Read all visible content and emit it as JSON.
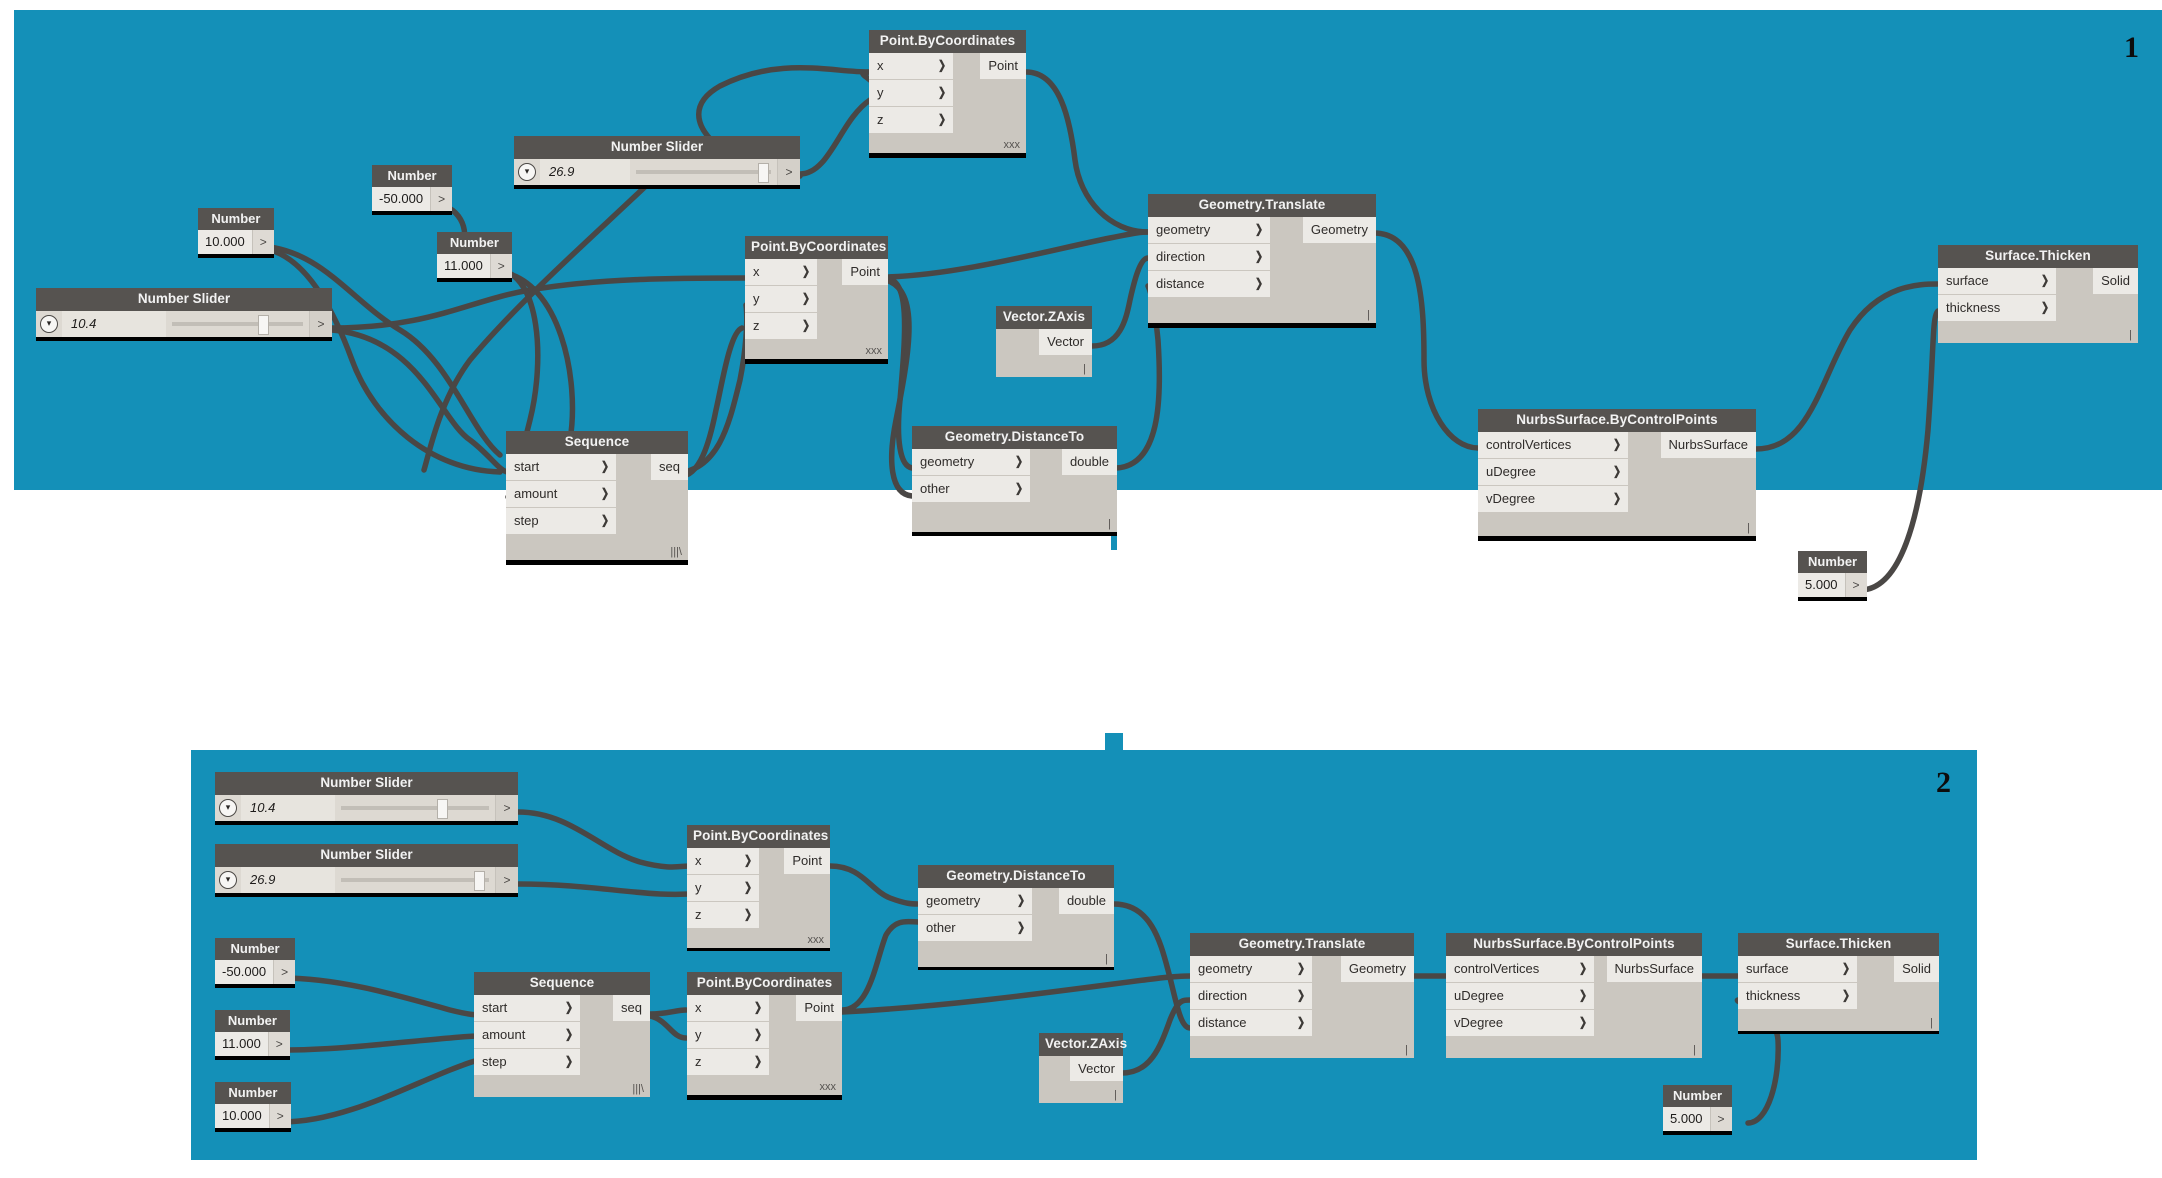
{
  "app": {
    "name": "Dynamo Visual Programming Graph",
    "background": "#1490b8",
    "node_header_color": "#565350",
    "node_body_color": "#cbc7c0",
    "port_color": "#eceae6",
    "wire_color": "#4a4745"
  },
  "panels": [
    {
      "badge": "1",
      "label": "graph-version-1"
    },
    {
      "badge": "2",
      "label": "graph-version-2"
    }
  ],
  "labels": {
    "go_arrow": ">",
    "chevron": "❯",
    "lacing_cross": "xxx",
    "lacing_longest": "|||\\",
    "lacing_shortest": "|"
  },
  "panel1": {
    "nodes": [
      {
        "id": "p1-slider-a",
        "type": "slider",
        "title": "Number Slider",
        "value": "10.4",
        "thumb_pct": 68
      },
      {
        "id": "p1-slider-b",
        "type": "slider",
        "title": "Number Slider",
        "value": "26.9",
        "thumb_pct": 91
      },
      {
        "id": "p1-num-10",
        "type": "number",
        "title": "Number",
        "value": "10.000",
        "go": ">"
      },
      {
        "id": "p1-num-m50",
        "type": "number",
        "title": "Number",
        "value": "-50.000",
        "go": ">"
      },
      {
        "id": "p1-num-11",
        "type": "number",
        "title": "Number",
        "value": "11.000",
        "go": ">"
      },
      {
        "id": "p1-num-5",
        "type": "number",
        "title": "Number",
        "value": "5.000",
        "go": ">"
      },
      {
        "id": "p1-pbc-top",
        "type": "node",
        "title": "Point.ByCoordinates",
        "inputs": [
          "x",
          "y",
          "z"
        ],
        "outputs": [
          "Point"
        ],
        "lacing": "xxx"
      },
      {
        "id": "p1-pbc-mid",
        "type": "node",
        "title": "Point.ByCoordinates",
        "inputs": [
          "x",
          "y",
          "z"
        ],
        "outputs": [
          "Point"
        ],
        "lacing": "xxx"
      },
      {
        "id": "p1-sequence",
        "type": "node",
        "title": "Sequence",
        "inputs": [
          "start",
          "amount",
          "step"
        ],
        "outputs": [
          "seq"
        ],
        "lacing": "|||\\"
      },
      {
        "id": "p1-distance",
        "type": "node",
        "title": "Geometry.DistanceTo",
        "inputs": [
          "geometry",
          "other"
        ],
        "outputs": [
          "double"
        ],
        "lacing": "|"
      },
      {
        "id": "p1-zaxis",
        "type": "node",
        "title": "Vector.ZAxis",
        "inputs": [],
        "outputs": [
          "Vector"
        ],
        "lacing": "|"
      },
      {
        "id": "p1-translate",
        "type": "node",
        "title": "Geometry.Translate",
        "inputs": [
          "geometry",
          "direction",
          "distance"
        ],
        "outputs": [
          "Geometry"
        ],
        "lacing": "|"
      },
      {
        "id": "p1-nurbs",
        "type": "node",
        "title": "NurbsSurface.ByControlPoints",
        "inputs": [
          "controlVertices",
          "uDegree",
          "vDegree"
        ],
        "outputs": [
          "NurbsSurface"
        ],
        "lacing": "|"
      },
      {
        "id": "p1-thicken",
        "type": "node",
        "title": "Surface.Thicken",
        "inputs": [
          "surface",
          "thickness"
        ],
        "outputs": [
          "Solid"
        ],
        "lacing": "|"
      }
    ]
  },
  "panel2": {
    "nodes": [
      {
        "id": "p2-slider-a",
        "type": "slider",
        "title": "Number Slider",
        "value": "10.4",
        "thumb_pct": 68
      },
      {
        "id": "p2-slider-b",
        "type": "slider",
        "title": "Number Slider",
        "value": "26.9",
        "thumb_pct": 91
      },
      {
        "id": "p2-num-m50",
        "type": "number",
        "title": "Number",
        "value": "-50.000",
        "go": ">"
      },
      {
        "id": "p2-num-11",
        "type": "number",
        "title": "Number",
        "value": "11.000",
        "go": ">"
      },
      {
        "id": "p2-num-10",
        "type": "number",
        "title": "Number",
        "value": "10.000",
        "go": ">"
      },
      {
        "id": "p2-num-5",
        "type": "number",
        "title": "Number",
        "value": "5.000",
        "go": ">"
      },
      {
        "id": "p2-pbc-top",
        "type": "node",
        "title": "Point.ByCoordinates",
        "inputs": [
          "x",
          "y",
          "z"
        ],
        "outputs": [
          "Point"
        ],
        "lacing": "xxx"
      },
      {
        "id": "p2-pbc-bot",
        "type": "node",
        "title": "Point.ByCoordinates",
        "inputs": [
          "x",
          "y",
          "z"
        ],
        "outputs": [
          "Point"
        ],
        "lacing": "xxx"
      },
      {
        "id": "p2-sequence",
        "type": "node",
        "title": "Sequence",
        "inputs": [
          "start",
          "amount",
          "step"
        ],
        "outputs": [
          "seq"
        ],
        "lacing": "|||\\"
      },
      {
        "id": "p2-distance",
        "type": "node",
        "title": "Geometry.DistanceTo",
        "inputs": [
          "geometry",
          "other"
        ],
        "outputs": [
          "double"
        ],
        "lacing": "|"
      },
      {
        "id": "p2-zaxis",
        "type": "node",
        "title": "Vector.ZAxis",
        "inputs": [],
        "outputs": [
          "Vector"
        ],
        "lacing": "|"
      },
      {
        "id": "p2-translate",
        "type": "node",
        "title": "Geometry.Translate",
        "inputs": [
          "geometry",
          "direction",
          "distance"
        ],
        "outputs": [
          "Geometry"
        ],
        "lacing": "|"
      },
      {
        "id": "p2-nurbs",
        "type": "node",
        "title": "NurbsSurface.ByControlPoints",
        "inputs": [
          "controlVertices",
          "uDegree",
          "vDegree"
        ],
        "outputs": [
          "NurbsSurface"
        ],
        "lacing": "|"
      },
      {
        "id": "p2-thicken",
        "type": "node",
        "title": "Surface.Thicken",
        "inputs": [
          "surface",
          "thickness"
        ],
        "outputs": [
          "Solid"
        ],
        "lacing": "|"
      }
    ]
  }
}
